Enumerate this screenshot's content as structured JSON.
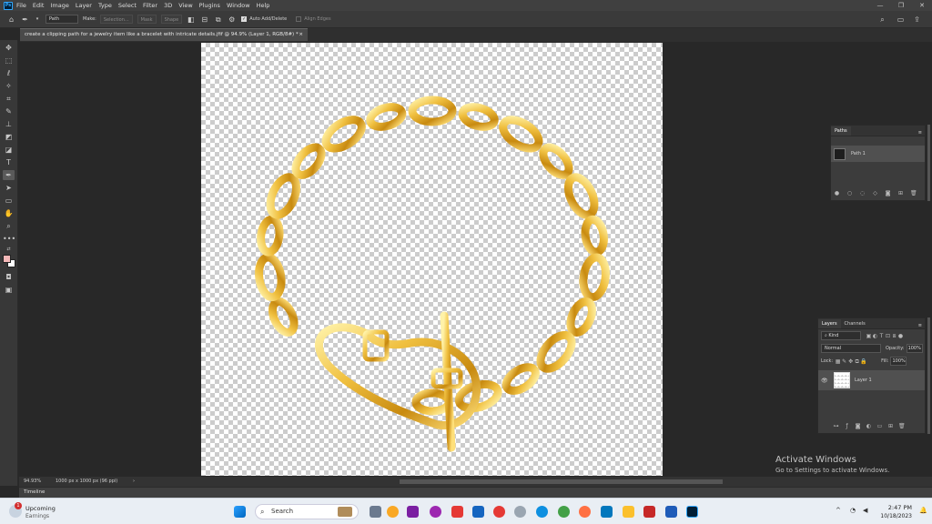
{
  "app": {
    "logo": "Ps",
    "menu": [
      "File",
      "Edit",
      "Image",
      "Layer",
      "Type",
      "Select",
      "Filter",
      "3D",
      "View",
      "Plugins",
      "Window",
      "Help"
    ],
    "window_controls": {
      "minimize": "—",
      "maximize": "❐",
      "close": "✕"
    }
  },
  "options": {
    "mode_value": "Path",
    "make_label": "Make:",
    "selection_label": "Selection...",
    "mask_label": "Mask",
    "shape_label": "Shape",
    "auto_add_delete_label": "Auto Add/Delete",
    "auto_add_delete_checked": true,
    "align_edges_label": "Align Edges"
  },
  "document": {
    "tab_title": "create a clipping path for a jewelry item like a bracelet with intricate details.jfif @ 94.9% (Layer 1, RGB/8#) *",
    "zoom": "94.93%",
    "info": "1000 px x 1000 px (96 ppi)"
  },
  "timeline_label": "Timeline",
  "paths_panel": {
    "tab": "Paths",
    "items": [
      {
        "name": "Path 1"
      }
    ]
  },
  "layers_panel": {
    "tabs": [
      "Layers",
      "Channels"
    ],
    "filter_kind": "Kind",
    "blend_mode": "Normal",
    "opacity_label": "Opacity:",
    "opacity_value": "100%",
    "lock_label": "Lock:",
    "fill_label": "Fill:",
    "fill_value": "100%",
    "layers": [
      {
        "name": "Layer 1",
        "visible": true
      }
    ]
  },
  "watermark": {
    "title": "Activate Windows",
    "subtitle": "Go to Settings to activate Windows."
  },
  "taskbar": {
    "weather_badge": "1",
    "weather_title": "Upcoming",
    "weather_sub": "Earnings",
    "search_placeholder": "Search",
    "time": "2:47 PM",
    "date": "10/18/2023"
  },
  "colors": {
    "foreground": "#f4b8b8",
    "background": "#ffffff",
    "gold": "#e0a820"
  }
}
